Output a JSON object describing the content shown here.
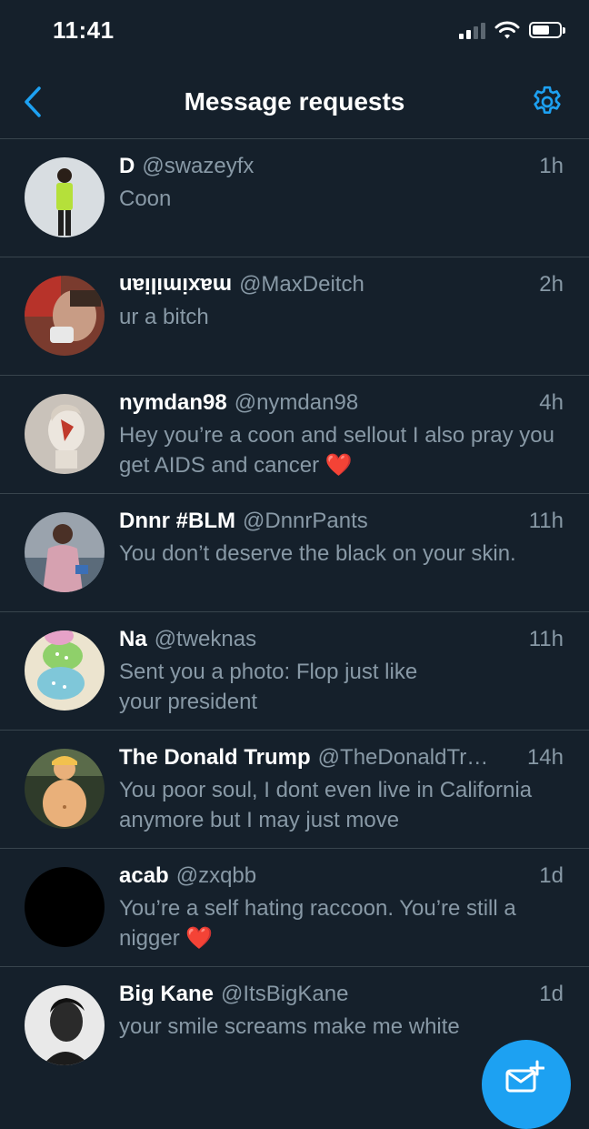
{
  "status_bar": {
    "time": "11:41"
  },
  "header": {
    "title": "Message requests",
    "back_icon": "chevron-left-icon",
    "settings_icon": "gear-icon"
  },
  "accent_color": "#1da1f2",
  "requests": [
    {
      "name": "D",
      "handle": "@swazeyfx",
      "time": "1h",
      "message": "Coon"
    },
    {
      "name": "maximilian",
      "name_display": "upside-down",
      "handle": "@MaxDeitch",
      "time": "2h",
      "message": "ur a bitch"
    },
    {
      "name": "nymdan98",
      "handle": "@nymdan98",
      "time": "4h",
      "message": "Hey you’re a coon and sellout I also pray you get AIDS and cancer",
      "emoji": "❤️"
    },
    {
      "name": "Dnnr #BLM",
      "handle": "@DnnrPants",
      "time": "11h",
      "message": "You don’t deserve the black on your skin."
    },
    {
      "name": "Na",
      "handle": "@tweknas",
      "time": "11h",
      "message": "Sent you a photo: Flop just like your president"
    },
    {
      "name": "The Donald Trump",
      "handle": "@TheDonaldTr…",
      "time": "14h",
      "message": "You poor soul, I dont even live in California anymore but I may just move"
    },
    {
      "name": "acab",
      "handle": "@zxqbb",
      "time": "1d",
      "message": "You’re a self hating raccoon. You’re still a nigger",
      "emoji": "❤️"
    },
    {
      "name": "Big Kane",
      "handle": "@ItsBigKane",
      "time": "1d",
      "message": "your smile screams make me white"
    }
  ],
  "fab": {
    "icon": "new-message-icon"
  }
}
